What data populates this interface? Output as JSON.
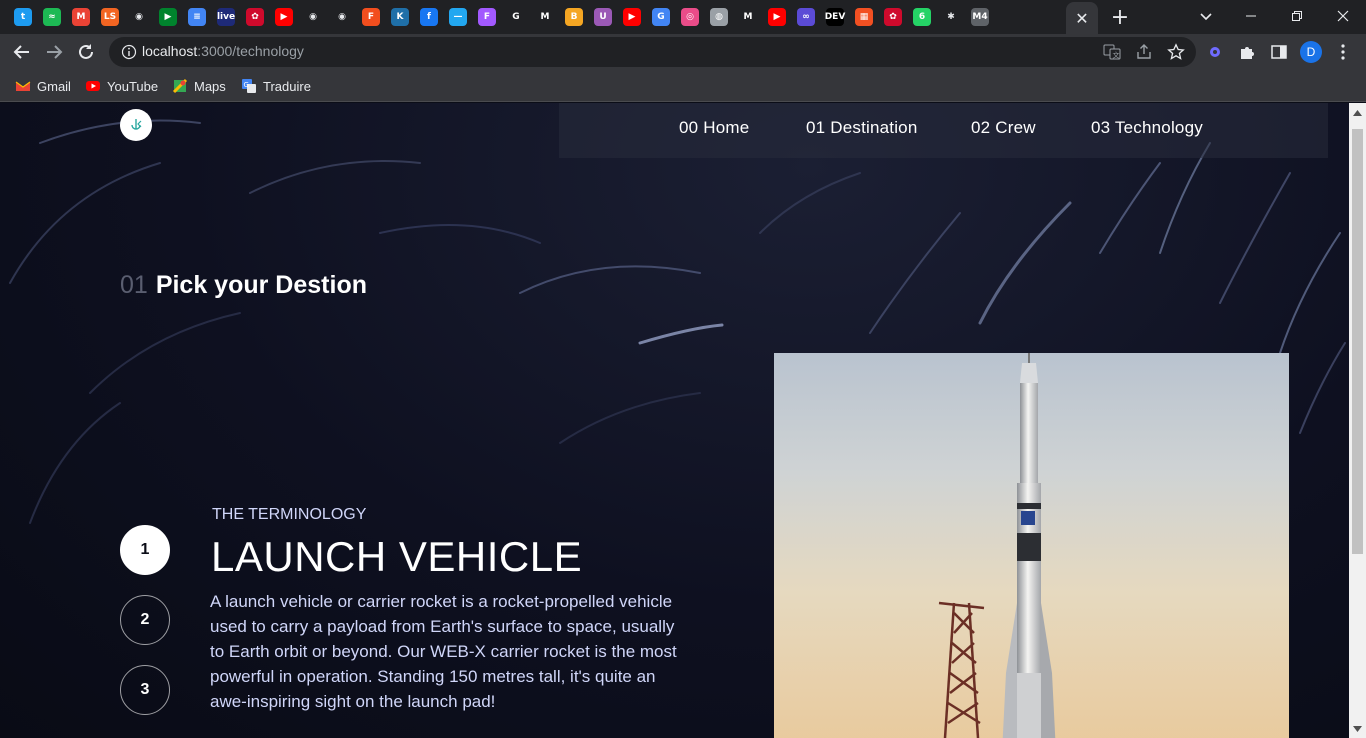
{
  "browser": {
    "tab_close_glyph": "✕",
    "new_tab_glyph": "+",
    "url_host": "localhost",
    "url_path": ":3000/technology",
    "profile_initial": "D",
    "bookmarks": [
      {
        "label": "Gmail",
        "icon": "gmail-icon"
      },
      {
        "label": "YouTube",
        "icon": "youtube-icon"
      },
      {
        "label": "Maps",
        "icon": "maps-icon"
      },
      {
        "label": "Traduire",
        "icon": "translate-icon"
      }
    ],
    "favicons": [
      {
        "icon": "twitter-icon",
        "color": "#1d9bf0",
        "glyph": "t"
      },
      {
        "icon": "spotify-icon",
        "color": "#1db954",
        "glyph": "≈"
      },
      {
        "icon": "gmail-icon",
        "color": "#ea4335",
        "glyph": "M"
      },
      {
        "icon": "ls-icon",
        "color": "#f26522",
        "glyph": "LS"
      },
      {
        "icon": "github-icon",
        "color": "#e8eaed",
        "glyph": "◉"
      },
      {
        "icon": "meet-icon",
        "color": "#00832d",
        "glyph": "▶"
      },
      {
        "icon": "docs-icon",
        "color": "#4285f4",
        "glyph": "≡"
      },
      {
        "icon": "live-icon",
        "color": "#1e2a78",
        "glyph": "live"
      },
      {
        "icon": "huawei-icon",
        "color": "#cf0a2c",
        "glyph": "✿"
      },
      {
        "icon": "youtube-icon",
        "color": "#ff0000",
        "glyph": "▶"
      },
      {
        "icon": "github-icon",
        "color": "#e8eaed",
        "glyph": "◉"
      },
      {
        "icon": "github-icon",
        "color": "#e8eaed",
        "glyph": "◉"
      },
      {
        "icon": "figma-icon",
        "color": "#f24e1e",
        "glyph": "F"
      },
      {
        "icon": "codewars-icon",
        "color": "#1f6fa8",
        "glyph": "K"
      },
      {
        "icon": "facebook-icon",
        "color": "#1877f2",
        "glyph": "f"
      },
      {
        "icon": "app-icon",
        "color": "#22a7f0",
        "glyph": "—"
      },
      {
        "icon": "figma-icon",
        "color": "#a259ff",
        "glyph": "F"
      },
      {
        "icon": "google-icon",
        "color": "#ffffff",
        "glyph": "G"
      },
      {
        "icon": "medium-icon",
        "color": "#ffffff",
        "glyph": "M"
      },
      {
        "icon": "badge-icon",
        "color": "#f5a623",
        "glyph": "B"
      },
      {
        "icon": "upwork-icon",
        "color": "#9b59b6",
        "glyph": "U"
      },
      {
        "icon": "youtube-icon",
        "color": "#ff0000",
        "glyph": "▶"
      },
      {
        "icon": "translate-icon",
        "color": "#4285f4",
        "glyph": "G"
      },
      {
        "icon": "dribbble-icon",
        "color": "#ea4c89",
        "glyph": "◎"
      },
      {
        "icon": "globe-icon",
        "color": "#9aa0a6",
        "glyph": "◍"
      },
      {
        "icon": "medium-icon",
        "color": "#ffffff",
        "glyph": "M"
      },
      {
        "icon": "youtube-icon",
        "color": "#ff0000",
        "glyph": "▶"
      },
      {
        "icon": "hashnode-icon",
        "color": "#5b4bd6",
        "glyph": "∞"
      },
      {
        "icon": "dev-icon",
        "color": "#000000",
        "glyph": "DEV"
      },
      {
        "icon": "microsoft-icon",
        "color": "#f25022",
        "glyph": "▦"
      },
      {
        "icon": "huawei-icon",
        "color": "#cf0a2c",
        "glyph": "✿"
      },
      {
        "icon": "whatsapp-icon",
        "color": "#25d366",
        "glyph": "6"
      },
      {
        "icon": "extension-icon",
        "color": "#e8eaed",
        "glyph": "✱"
      },
      {
        "icon": "m4-icon",
        "color": "#5f6368",
        "glyph": "M4"
      }
    ]
  },
  "page": {
    "nav": [
      {
        "label": "00 Home"
      },
      {
        "label": "01 Destination"
      },
      {
        "label": "02 Crew"
      },
      {
        "label": "03 Technology"
      }
    ],
    "heading_number": "01",
    "heading_text": "Pick your Destion",
    "steps": [
      "1",
      "2",
      "3"
    ],
    "active_step": "1",
    "eyebrow": "THE TERMINOLOGY",
    "title": "LAUNCH VEHICLE",
    "description": "A launch vehicle or carrier rocket is a rocket-propelled vehicle used to carry a payload from Earth's surface to space, usually to Earth orbit or beyond. Our WEB-X carrier rocket is the most powerful in operation. Standing 150 metres tall, it's quite an awe-inspiring sight on the launch pad!"
  }
}
